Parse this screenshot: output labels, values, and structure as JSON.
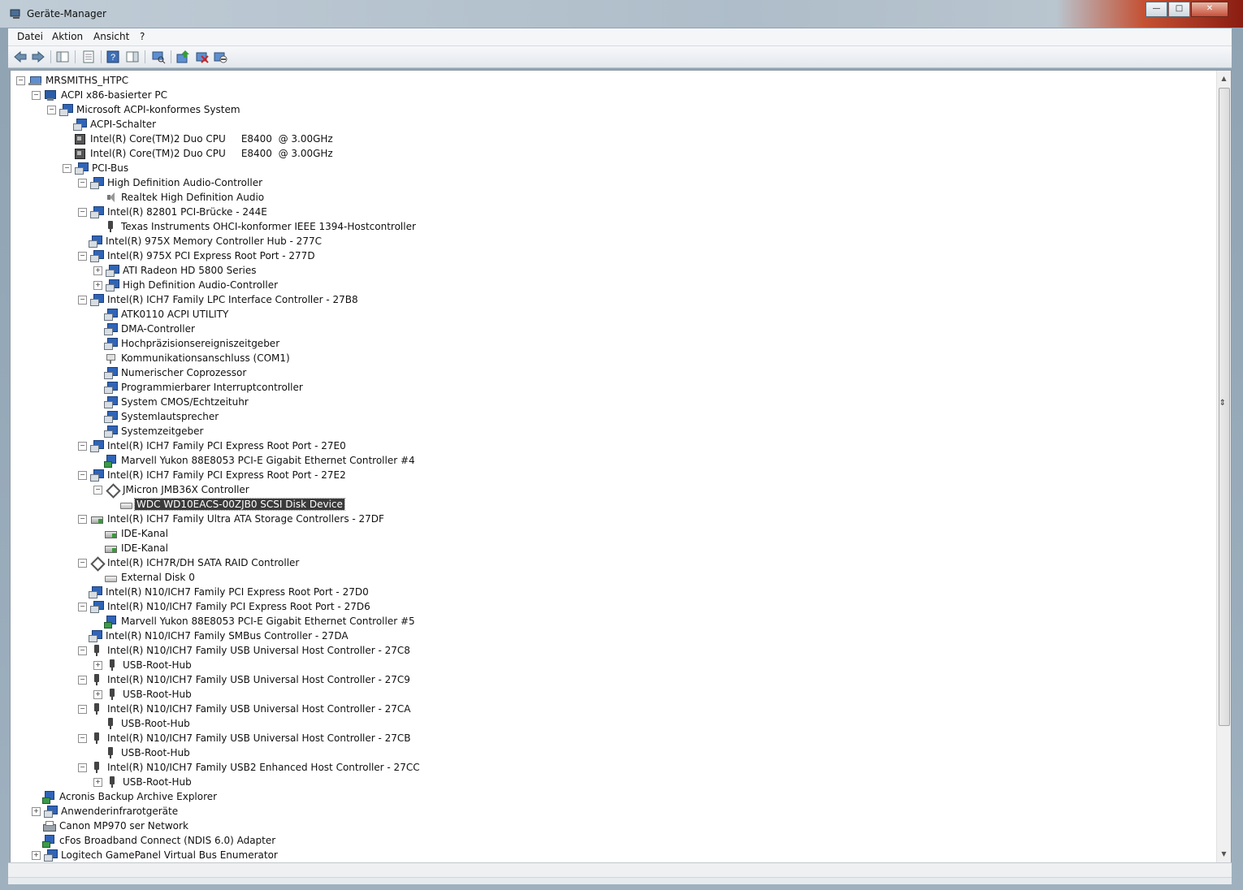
{
  "window": {
    "title": "Geräte-Manager"
  },
  "menu": [
    {
      "label": "Datei"
    },
    {
      "label": "Aktion"
    },
    {
      "label": "Ansicht"
    },
    {
      "label": "?"
    }
  ],
  "toolbar": {
    "buttons": [
      "back-icon",
      "forward-icon",
      "console-tree-icon",
      "properties-icon",
      "help-icon",
      "action-pane-icon",
      "scan-hardware-icon",
      "update-driver-icon",
      "uninstall-icon",
      "disable-icon"
    ]
  },
  "tree": [
    {
      "label": "MRSMITHS_HTPC",
      "level": 0,
      "exp": "minus",
      "icon": "root"
    },
    {
      "label": "ACPI x86-basierter PC",
      "level": 1,
      "exp": "minus",
      "icon": "pc"
    },
    {
      "label": "Microsoft ACPI-konformes System",
      "level": 2,
      "exp": "minus",
      "icon": "dev"
    },
    {
      "label": "ACPI-Schalter",
      "level": 3,
      "exp": "none",
      "icon": "dev"
    },
    {
      "label": "Intel(R) Core(TM)2 Duo CPU     E8400  @ 3.00GHz",
      "level": 3,
      "exp": "none",
      "icon": "cpu"
    },
    {
      "label": "Intel(R) Core(TM)2 Duo CPU     E8400  @ 3.00GHz",
      "level": 3,
      "exp": "none",
      "icon": "cpu"
    },
    {
      "label": "PCI-Bus",
      "level": 3,
      "exp": "minus",
      "icon": "dev"
    },
    {
      "label": "High Definition Audio-Controller",
      "level": 4,
      "exp": "minus",
      "icon": "dev"
    },
    {
      "label": "Realtek High Definition Audio",
      "level": 5,
      "exp": "none",
      "icon": "audio"
    },
    {
      "label": "Intel(R) 82801 PCI-Brücke - 244E",
      "level": 4,
      "exp": "minus",
      "icon": "dev"
    },
    {
      "label": "Texas Instruments OHCI-konformer IEEE 1394-Hostcontroller",
      "level": 5,
      "exp": "none",
      "icon": "usb"
    },
    {
      "label": "Intel(R) 975X Memory Controller Hub - 277C",
      "level": 4,
      "exp": "none",
      "icon": "dev"
    },
    {
      "label": "Intel(R) 975X PCI Express Root Port - 277D",
      "level": 4,
      "exp": "minus",
      "icon": "dev"
    },
    {
      "label": "ATI Radeon HD 5800 Series",
      "level": 5,
      "exp": "plus",
      "icon": "dev"
    },
    {
      "label": "High Definition Audio-Controller",
      "level": 5,
      "exp": "plus",
      "icon": "dev"
    },
    {
      "label": "Intel(R) ICH7 Family LPC Interface Controller - 27B8",
      "level": 4,
      "exp": "minus",
      "icon": "dev"
    },
    {
      "label": "ATK0110 ACPI UTILITY",
      "level": 5,
      "exp": "none",
      "icon": "dev"
    },
    {
      "label": "DMA-Controller",
      "level": 5,
      "exp": "none",
      "icon": "dev"
    },
    {
      "label": "Hochpräzisionsereigniszeitgeber",
      "level": 5,
      "exp": "none",
      "icon": "dev"
    },
    {
      "label": "Kommunikationsanschluss (COM1)",
      "level": 5,
      "exp": "none",
      "icon": "port"
    },
    {
      "label": "Numerischer Coprozessor",
      "level": 5,
      "exp": "none",
      "icon": "dev"
    },
    {
      "label": "Programmierbarer Interruptcontroller",
      "level": 5,
      "exp": "none",
      "icon": "dev"
    },
    {
      "label": "System CMOS/Echtzeituhr",
      "level": 5,
      "exp": "none",
      "icon": "dev"
    },
    {
      "label": "Systemlautsprecher",
      "level": 5,
      "exp": "none",
      "icon": "dev"
    },
    {
      "label": "Systemzeitgeber",
      "level": 5,
      "exp": "none",
      "icon": "dev"
    },
    {
      "label": "Intel(R) ICH7 Family PCI Express Root Port - 27E0",
      "level": 4,
      "exp": "minus",
      "icon": "dev"
    },
    {
      "label": "Marvell Yukon 88E8053 PCI-E Gigabit Ethernet Controller #4",
      "level": 5,
      "exp": "none",
      "icon": "net"
    },
    {
      "label": "Intel(R) ICH7 Family PCI Express Root Port - 27E2",
      "level": 4,
      "exp": "minus",
      "icon": "dev"
    },
    {
      "label": "JMicron JMB36X Controller",
      "level": 5,
      "exp": "minus",
      "icon": "scsi"
    },
    {
      "label": "WDC WD10EACS-00ZJB0 SCSI Disk Device",
      "level": 6,
      "exp": "none",
      "icon": "disk",
      "selected": true
    },
    {
      "label": "Intel(R) ICH7 Family Ultra ATA Storage Controllers - 27DF",
      "level": 4,
      "exp": "minus",
      "icon": "ide"
    },
    {
      "label": "IDE-Kanal",
      "level": 5,
      "exp": "none",
      "icon": "ide"
    },
    {
      "label": "IDE-Kanal",
      "level": 5,
      "exp": "none",
      "icon": "ide"
    },
    {
      "label": "Intel(R) ICH7R/DH SATA RAID Controller",
      "level": 4,
      "exp": "minus",
      "icon": "scsi"
    },
    {
      "label": "External Disk 0",
      "level": 5,
      "exp": "none",
      "icon": "disk"
    },
    {
      "label": "Intel(R) N10/ICH7 Family PCI Express Root Port - 27D0",
      "level": 4,
      "exp": "none",
      "icon": "dev"
    },
    {
      "label": "Intel(R) N10/ICH7 Family PCI Express Root Port - 27D6",
      "level": 4,
      "exp": "minus",
      "icon": "dev"
    },
    {
      "label": "Marvell Yukon 88E8053 PCI-E Gigabit Ethernet Controller #5",
      "level": 5,
      "exp": "none",
      "icon": "net"
    },
    {
      "label": "Intel(R) N10/ICH7 Family SMBus Controller - 27DA",
      "level": 4,
      "exp": "none",
      "icon": "dev"
    },
    {
      "label": "Intel(R) N10/ICH7 Family USB Universal Host Controller - 27C8",
      "level": 4,
      "exp": "minus",
      "icon": "usb"
    },
    {
      "label": "USB-Root-Hub",
      "level": 5,
      "exp": "plus",
      "icon": "usb"
    },
    {
      "label": "Intel(R) N10/ICH7 Family USB Universal Host Controller - 27C9",
      "level": 4,
      "exp": "minus",
      "icon": "usb"
    },
    {
      "label": "USB-Root-Hub",
      "level": 5,
      "exp": "plus",
      "icon": "usb"
    },
    {
      "label": "Intel(R) N10/ICH7 Family USB Universal Host Controller - 27CA",
      "level": 4,
      "exp": "minus",
      "icon": "usb"
    },
    {
      "label": "USB-Root-Hub",
      "level": 5,
      "exp": "none",
      "icon": "usb"
    },
    {
      "label": "Intel(R) N10/ICH7 Family USB Universal Host Controller - 27CB",
      "level": 4,
      "exp": "minus",
      "icon": "usb"
    },
    {
      "label": "USB-Root-Hub",
      "level": 5,
      "exp": "none",
      "icon": "usb"
    },
    {
      "label": "Intel(R) N10/ICH7 Family USB2 Enhanced Host Controller - 27CC",
      "level": 4,
      "exp": "minus",
      "icon": "usb"
    },
    {
      "label": "USB-Root-Hub",
      "level": 5,
      "exp": "plus",
      "icon": "usb"
    },
    {
      "label": "Acronis Backup Archive Explorer",
      "level": 1,
      "exp": "none",
      "icon": "net"
    },
    {
      "label": "Anwenderinfrarotgeräte",
      "level": 1,
      "exp": "plus",
      "icon": "dev"
    },
    {
      "label": "Canon MP970 ser Network",
      "level": 1,
      "exp": "none",
      "icon": "printer"
    },
    {
      "label": "cFos Broadband Connect (NDIS 6.0) Adapter",
      "level": 1,
      "exp": "none",
      "icon": "net"
    },
    {
      "label": "Logitech GamePanel Virtual Bus Enumerator",
      "level": 1,
      "exp": "plus",
      "icon": "dev"
    }
  ]
}
